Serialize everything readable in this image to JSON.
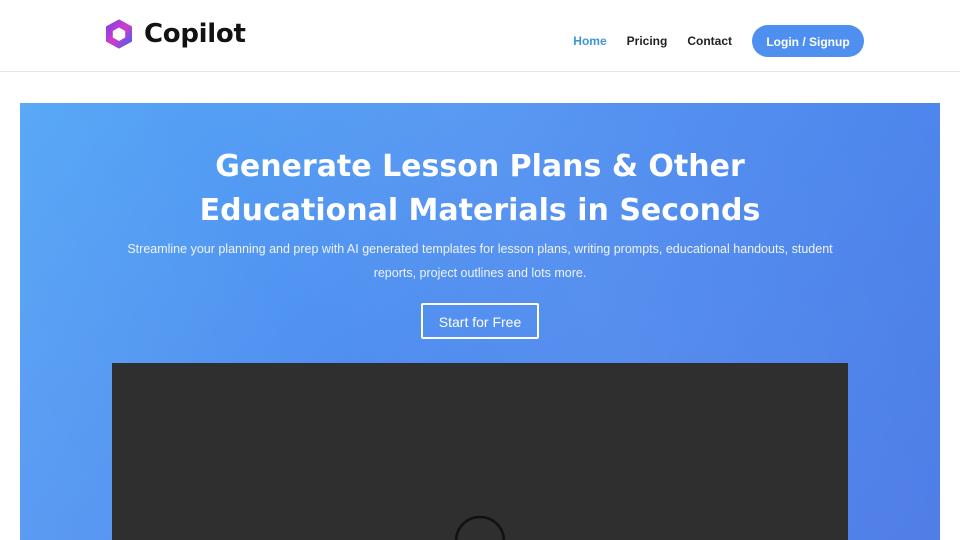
{
  "brand": {
    "name": "Copilot",
    "logo_icon": "hexagon-gradient-logo-icon",
    "logo_colors": [
      "#7b3fe4",
      "#d23cc8",
      "#3f5ef5"
    ]
  },
  "nav": {
    "links": [
      {
        "label": "Home",
        "active": true
      },
      {
        "label": "Pricing",
        "active": false
      },
      {
        "label": "Contact",
        "active": false
      }
    ],
    "login_label": "Login / Signup"
  },
  "hero": {
    "title": "Generate Lesson Plans & Other Educational Materials in Seconds",
    "subtitle": "Streamline your planning and prep with AI generated templates for lesson plans, writing prompts, educational handouts, student reports, project outlines and lots more.",
    "cta_label": "Start for Free"
  },
  "video": {
    "state": "loading",
    "icon": "loading-spinner-icon"
  },
  "colors": {
    "accent": "#4f8ff0",
    "active_nav": "#3d96d8",
    "hero_gradient_start": "#56a6f6",
    "hero_gradient_end": "#4a7ae6",
    "video_bg": "#2f2f2f"
  }
}
